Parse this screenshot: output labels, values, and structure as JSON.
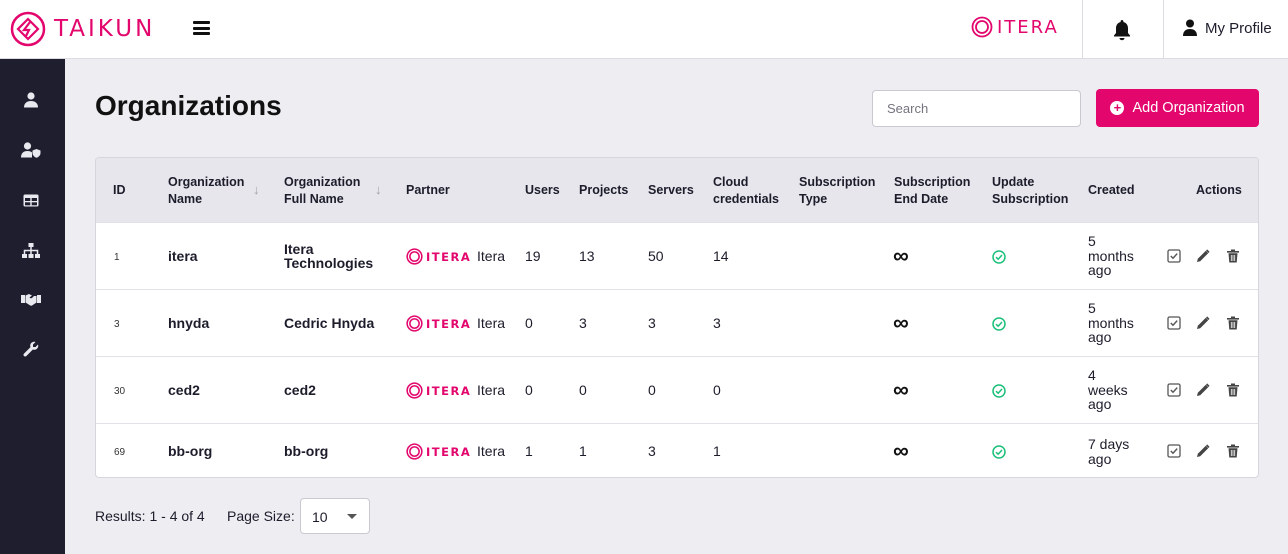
{
  "brand": {
    "name": "TAIKUN",
    "color": "#e3066d"
  },
  "header": {
    "partner_logo_text": "ITERA",
    "profile_label": "My Profile"
  },
  "sidebar": {
    "items": [
      {
        "icon": "user-icon"
      },
      {
        "icon": "user-shield-icon"
      },
      {
        "icon": "table-icon"
      },
      {
        "icon": "sitemap-icon"
      },
      {
        "icon": "handshake-icon"
      },
      {
        "icon": "wrench-icon"
      }
    ]
  },
  "page": {
    "title": "Organizations",
    "search_placeholder": "Search",
    "add_button": "Add Organization"
  },
  "table": {
    "columns": {
      "id": "ID",
      "org_name_1": "Organization",
      "org_name_2": "Name",
      "full_name_1": "Organization",
      "full_name_2": "Full Name",
      "partner": "Partner",
      "users": "Users",
      "projects": "Projects",
      "servers": "Servers",
      "cloud_1": "Cloud",
      "cloud_2": "credentials",
      "subtype_1": "Subscription",
      "subtype_2": "Type",
      "subend_1": "Subscription",
      "subend_2": "End Date",
      "update_1": "Update",
      "update_2": "Subscription",
      "created": "Created",
      "actions": "Actions"
    },
    "rows": [
      {
        "id": "1",
        "name": "itera",
        "full_name_1": "Itera",
        "full_name_2": "Technologies",
        "partner_logo": "ITERA",
        "partner": "Itera",
        "users": "19",
        "projects": "13",
        "servers": "50",
        "cloud": "14",
        "end_date": "∞",
        "created_1": "5",
        "created_2": "months",
        "created_3": "ago"
      },
      {
        "id": "3",
        "name": "hnyda",
        "full_name_1": "Cedric Hnyda",
        "full_name_2": "",
        "partner_logo": "ITERA",
        "partner": "Itera",
        "users": "0",
        "projects": "3",
        "servers": "3",
        "cloud": "3",
        "end_date": "∞",
        "created_1": "5",
        "created_2": "months",
        "created_3": "ago"
      },
      {
        "id": "30",
        "name": "ced2",
        "full_name_1": "ced2",
        "full_name_2": "",
        "partner_logo": "ITERA",
        "partner": "Itera",
        "users": "0",
        "projects": "0",
        "servers": "0",
        "cloud": "0",
        "end_date": "∞",
        "created_1": "4",
        "created_2": "weeks",
        "created_3": "ago"
      },
      {
        "id": "69",
        "name": "bb-org",
        "full_name_1": "bb-org",
        "full_name_2": "",
        "partner_logo": "ITERA",
        "partner": "Itera",
        "users": "1",
        "projects": "1",
        "servers": "3",
        "cloud": "1",
        "end_date": "∞",
        "created_1": "7 days",
        "created_2": "ago",
        "created_3": ""
      }
    ]
  },
  "footer": {
    "results": "Results: 1 - 4 of 4",
    "page_size_label": "Page Size:",
    "page_size_value": "10"
  },
  "colors": {
    "accent": "#e3066d",
    "sidebar": "#1e1e2f",
    "success": "#1bbf7a"
  }
}
